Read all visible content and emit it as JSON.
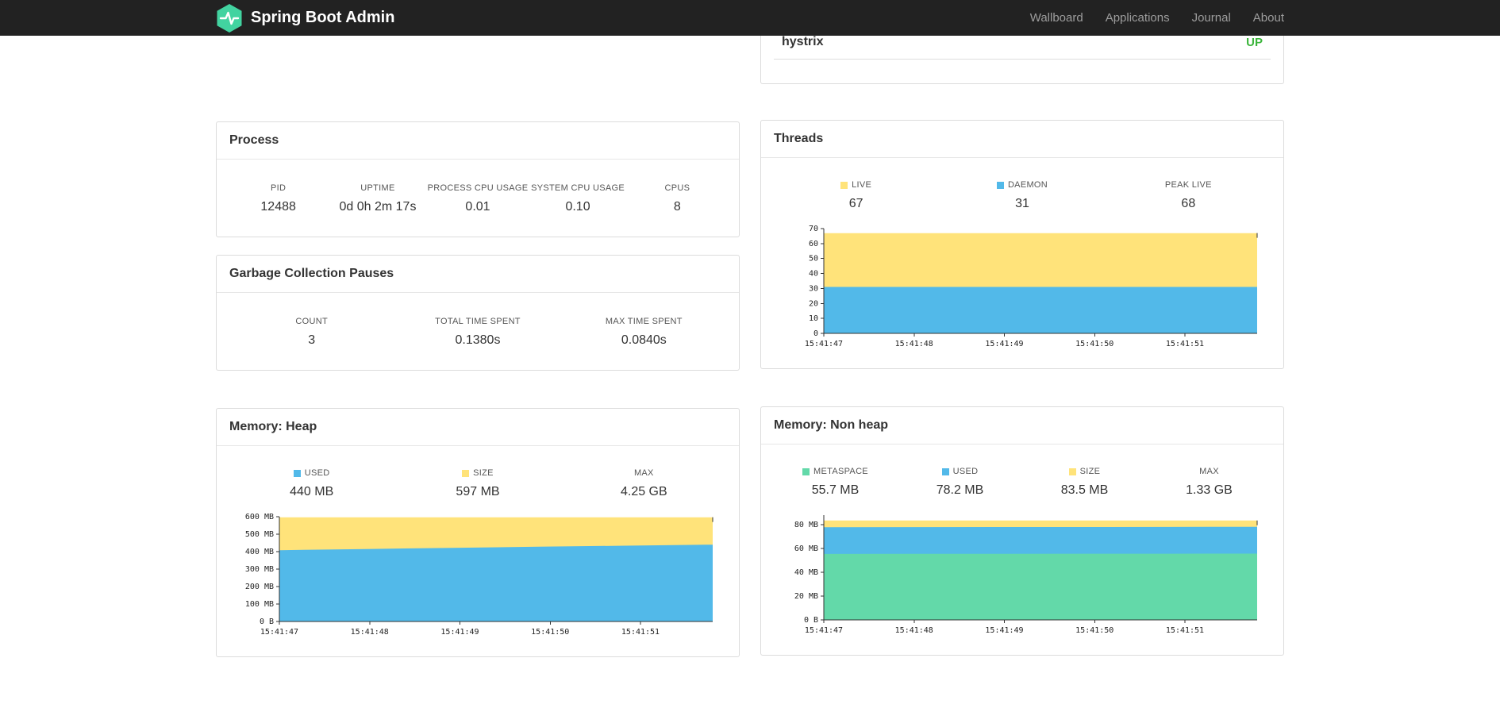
{
  "navbar": {
    "brand": "Spring Boot Admin",
    "items": [
      {
        "label": "Wallboard"
      },
      {
        "label": "Applications"
      },
      {
        "label": "Journal"
      },
      {
        "label": "About"
      }
    ]
  },
  "colors": {
    "navbar_bg": "#222222",
    "logo_green": "#42d3a0",
    "status_up": "#3cb53c",
    "series_yellow": "#ffe37a",
    "series_blue": "#52b9e9",
    "series_green": "#63d9a9"
  },
  "health": {
    "name": "hystrix",
    "status": "UP"
  },
  "process": {
    "title": "Process",
    "stats": [
      {
        "label": "PID",
        "value": "12488"
      },
      {
        "label": "UPTIME",
        "value": "0d 0h 2m 17s"
      },
      {
        "label": "PROCESS CPU USAGE",
        "value": "0.01"
      },
      {
        "label": "SYSTEM CPU USAGE",
        "value": "0.10"
      },
      {
        "label": "CPUS",
        "value": "8"
      }
    ]
  },
  "gc": {
    "title": "Garbage Collection Pauses",
    "stats": [
      {
        "label": "COUNT",
        "value": "3"
      },
      {
        "label": "TOTAL TIME SPENT",
        "value": "0.1380s"
      },
      {
        "label": "MAX TIME SPENT",
        "value": "0.0840s"
      }
    ]
  },
  "threads": {
    "title": "Threads",
    "legend": [
      {
        "label": "LIVE",
        "value": "67"
      },
      {
        "label": "DAEMON",
        "value": "31"
      },
      {
        "label": "PEAK LIVE",
        "value": "68"
      }
    ]
  },
  "heap": {
    "title": "Memory: Heap",
    "legend": [
      {
        "label": "USED",
        "value": "440 MB"
      },
      {
        "label": "SIZE",
        "value": "597 MB"
      },
      {
        "label": "MAX",
        "value": "4.25 GB"
      }
    ]
  },
  "nonheap": {
    "title": "Memory: Non heap",
    "legend": [
      {
        "label": "METASPACE",
        "value": "55.7 MB"
      },
      {
        "label": "USED",
        "value": "78.2 MB"
      },
      {
        "label": "SIZE",
        "value": "83.5 MB"
      },
      {
        "label": "MAX",
        "value": "1.33 GB"
      }
    ]
  },
  "chart_data": [
    {
      "id": "threads",
      "type": "area",
      "title": "Threads",
      "ylim": [
        0,
        70
      ],
      "ymax": 70,
      "yticks": [
        {
          "v": 0,
          "label": "0"
        },
        {
          "v": 10,
          "label": "10"
        },
        {
          "v": 20,
          "label": "20"
        },
        {
          "v": 30,
          "label": "30"
        },
        {
          "v": 40,
          "label": "40"
        },
        {
          "v": 50,
          "label": "50"
        },
        {
          "v": 60,
          "label": "60"
        },
        {
          "v": 70,
          "label": "70"
        }
      ],
      "xlabels": [
        "15:41:47",
        "15:41:48",
        "15:41:49",
        "15:41:50",
        "15:41:51"
      ],
      "layers": [
        {
          "name": "live",
          "color": "#ffe37a",
          "values": [
            67,
            67,
            67,
            67,
            67,
            67
          ]
        },
        {
          "name": "daemon",
          "color": "#52b9e9",
          "values": [
            31,
            31,
            31,
            31,
            31,
            31
          ]
        }
      ]
    },
    {
      "id": "heap",
      "type": "area",
      "title": "Memory: Heap",
      "ylim": [
        0,
        600
      ],
      "ymax": 600,
      "yticks": [
        {
          "v": 0,
          "label": "0 B"
        },
        {
          "v": 100,
          "label": "100 MB"
        },
        {
          "v": 200,
          "label": "200 MB"
        },
        {
          "v": 300,
          "label": "300 MB"
        },
        {
          "v": 400,
          "label": "400 MB"
        },
        {
          "v": 500,
          "label": "500 MB"
        },
        {
          "v": 600,
          "label": "600 MB"
        }
      ],
      "xlabels": [
        "15:41:47",
        "15:41:48",
        "15:41:49",
        "15:41:50",
        "15:41:51"
      ],
      "layers": [
        {
          "name": "size",
          "color": "#ffe37a",
          "values": [
            597,
            597,
            597,
            597,
            597,
            597
          ]
        },
        {
          "name": "used",
          "color": "#52b9e9",
          "values": [
            408,
            415,
            422,
            428,
            434,
            440
          ]
        }
      ]
    },
    {
      "id": "nonheap",
      "type": "area",
      "title": "Memory: Non heap",
      "ylim": [
        0,
        88
      ],
      "ymax": 88,
      "yticks": [
        {
          "v": 0,
          "label": "0 B"
        },
        {
          "v": 20,
          "label": "20 MB"
        },
        {
          "v": 40,
          "label": "40 MB"
        },
        {
          "v": 60,
          "label": "60 MB"
        },
        {
          "v": 80,
          "label": "80 MB"
        }
      ],
      "xlabels": [
        "15:41:47",
        "15:41:48",
        "15:41:49",
        "15:41:50",
        "15:41:51"
      ],
      "layers": [
        {
          "name": "size",
          "color": "#ffe37a",
          "values": [
            83.5,
            83.5,
            83.5,
            83.5,
            83.5,
            83.5
          ]
        },
        {
          "name": "used",
          "color": "#52b9e9",
          "values": [
            77.8,
            77.9,
            78.0,
            78.0,
            78.1,
            78.2
          ]
        },
        {
          "name": "metaspace",
          "color": "#63d9a9",
          "values": [
            55.4,
            55.5,
            55.5,
            55.6,
            55.6,
            55.7
          ]
        }
      ]
    }
  ]
}
